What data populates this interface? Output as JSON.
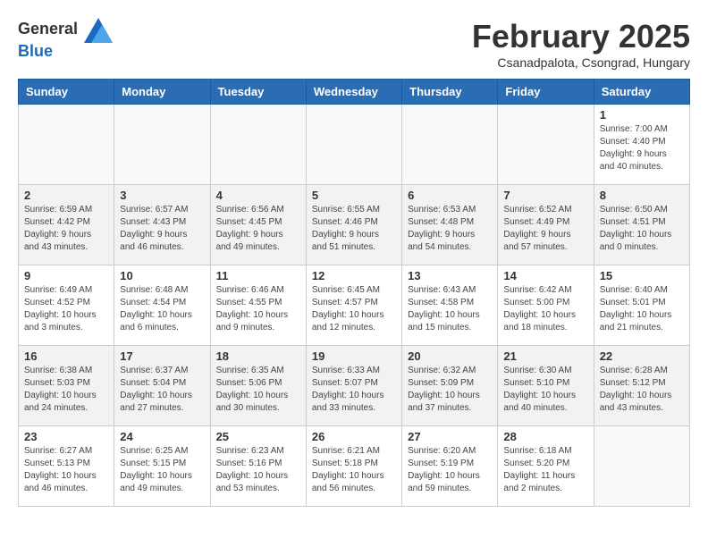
{
  "header": {
    "logo_general": "General",
    "logo_blue": "Blue",
    "title": "February 2025",
    "subtitle": "Csanadpalota, Csongrad, Hungary"
  },
  "weekdays": [
    "Sunday",
    "Monday",
    "Tuesday",
    "Wednesday",
    "Thursday",
    "Friday",
    "Saturday"
  ],
  "weeks": [
    [
      {
        "day": "",
        "info": ""
      },
      {
        "day": "",
        "info": ""
      },
      {
        "day": "",
        "info": ""
      },
      {
        "day": "",
        "info": ""
      },
      {
        "day": "",
        "info": ""
      },
      {
        "day": "",
        "info": ""
      },
      {
        "day": "1",
        "info": "Sunrise: 7:00 AM\nSunset: 4:40 PM\nDaylight: 9 hours and 40 minutes."
      }
    ],
    [
      {
        "day": "2",
        "info": "Sunrise: 6:59 AM\nSunset: 4:42 PM\nDaylight: 9 hours and 43 minutes."
      },
      {
        "day": "3",
        "info": "Sunrise: 6:57 AM\nSunset: 4:43 PM\nDaylight: 9 hours and 46 minutes."
      },
      {
        "day": "4",
        "info": "Sunrise: 6:56 AM\nSunset: 4:45 PM\nDaylight: 9 hours and 49 minutes."
      },
      {
        "day": "5",
        "info": "Sunrise: 6:55 AM\nSunset: 4:46 PM\nDaylight: 9 hours and 51 minutes."
      },
      {
        "day": "6",
        "info": "Sunrise: 6:53 AM\nSunset: 4:48 PM\nDaylight: 9 hours and 54 minutes."
      },
      {
        "day": "7",
        "info": "Sunrise: 6:52 AM\nSunset: 4:49 PM\nDaylight: 9 hours and 57 minutes."
      },
      {
        "day": "8",
        "info": "Sunrise: 6:50 AM\nSunset: 4:51 PM\nDaylight: 10 hours and 0 minutes."
      }
    ],
    [
      {
        "day": "9",
        "info": "Sunrise: 6:49 AM\nSunset: 4:52 PM\nDaylight: 10 hours and 3 minutes."
      },
      {
        "day": "10",
        "info": "Sunrise: 6:48 AM\nSunset: 4:54 PM\nDaylight: 10 hours and 6 minutes."
      },
      {
        "day": "11",
        "info": "Sunrise: 6:46 AM\nSunset: 4:55 PM\nDaylight: 10 hours and 9 minutes."
      },
      {
        "day": "12",
        "info": "Sunrise: 6:45 AM\nSunset: 4:57 PM\nDaylight: 10 hours and 12 minutes."
      },
      {
        "day": "13",
        "info": "Sunrise: 6:43 AM\nSunset: 4:58 PM\nDaylight: 10 hours and 15 minutes."
      },
      {
        "day": "14",
        "info": "Sunrise: 6:42 AM\nSunset: 5:00 PM\nDaylight: 10 hours and 18 minutes."
      },
      {
        "day": "15",
        "info": "Sunrise: 6:40 AM\nSunset: 5:01 PM\nDaylight: 10 hours and 21 minutes."
      }
    ],
    [
      {
        "day": "16",
        "info": "Sunrise: 6:38 AM\nSunset: 5:03 PM\nDaylight: 10 hours and 24 minutes."
      },
      {
        "day": "17",
        "info": "Sunrise: 6:37 AM\nSunset: 5:04 PM\nDaylight: 10 hours and 27 minutes."
      },
      {
        "day": "18",
        "info": "Sunrise: 6:35 AM\nSunset: 5:06 PM\nDaylight: 10 hours and 30 minutes."
      },
      {
        "day": "19",
        "info": "Sunrise: 6:33 AM\nSunset: 5:07 PM\nDaylight: 10 hours and 33 minutes."
      },
      {
        "day": "20",
        "info": "Sunrise: 6:32 AM\nSunset: 5:09 PM\nDaylight: 10 hours and 37 minutes."
      },
      {
        "day": "21",
        "info": "Sunrise: 6:30 AM\nSunset: 5:10 PM\nDaylight: 10 hours and 40 minutes."
      },
      {
        "day": "22",
        "info": "Sunrise: 6:28 AM\nSunset: 5:12 PM\nDaylight: 10 hours and 43 minutes."
      }
    ],
    [
      {
        "day": "23",
        "info": "Sunrise: 6:27 AM\nSunset: 5:13 PM\nDaylight: 10 hours and 46 minutes."
      },
      {
        "day": "24",
        "info": "Sunrise: 6:25 AM\nSunset: 5:15 PM\nDaylight: 10 hours and 49 minutes."
      },
      {
        "day": "25",
        "info": "Sunrise: 6:23 AM\nSunset: 5:16 PM\nDaylight: 10 hours and 53 minutes."
      },
      {
        "day": "26",
        "info": "Sunrise: 6:21 AM\nSunset: 5:18 PM\nDaylight: 10 hours and 56 minutes."
      },
      {
        "day": "27",
        "info": "Sunrise: 6:20 AM\nSunset: 5:19 PM\nDaylight: 10 hours and 59 minutes."
      },
      {
        "day": "28",
        "info": "Sunrise: 6:18 AM\nSunset: 5:20 PM\nDaylight: 11 hours and 2 minutes."
      },
      {
        "day": "",
        "info": ""
      }
    ]
  ]
}
